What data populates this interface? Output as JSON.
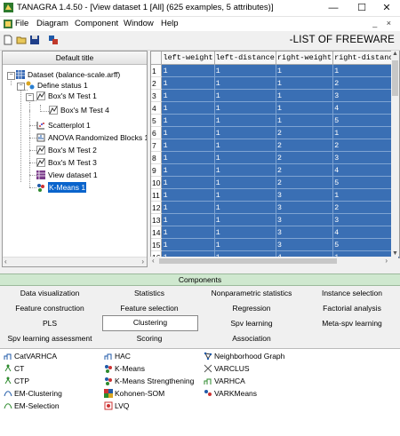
{
  "window": {
    "title": "TANAGRA 1.4.50 - [View dataset 1 [All] (625 examples, 5 attributes)]",
    "minimize": "—",
    "maximize": "☐",
    "close": "✕"
  },
  "menu": {
    "items": [
      "File",
      "Diagram",
      "Component",
      "Window",
      "Help"
    ],
    "mdi_controls": "_ ×"
  },
  "toolbar": {
    "banner": "-LIST OF FREEWARE"
  },
  "tree": {
    "header": "Default title",
    "nodes": [
      {
        "label": "Dataset (balance-scale.arff)",
        "icon": "dataset-icon"
      },
      {
        "label": "Define status 1",
        "icon": "define-status-icon"
      },
      {
        "label": "Box's M Test 1",
        "icon": "boxm-icon"
      },
      {
        "label": "Box's M Test 4",
        "icon": "boxm-icon"
      },
      {
        "label": "Scatterplot 1",
        "icon": "scatterplot-icon"
      },
      {
        "label": "ANOVA Randomized Blocks 1",
        "icon": "anova-icon"
      },
      {
        "label": "Box's M Test 2",
        "icon": "boxm-icon"
      },
      {
        "label": "Box's M Test 3",
        "icon": "boxm-icon"
      },
      {
        "label": "View dataset 1",
        "icon": "view-dataset-icon"
      },
      {
        "label": "K-Means 1",
        "icon": "kmeans-icon"
      }
    ]
  },
  "grid": {
    "columns": [
      "",
      "left-weight",
      "left-distance",
      "right-weight",
      "right-distance"
    ],
    "rows": [
      [
        "1",
        "1",
        "1",
        "1",
        "1"
      ],
      [
        "2",
        "1",
        "1",
        "1",
        "2"
      ],
      [
        "3",
        "1",
        "1",
        "1",
        "3"
      ],
      [
        "4",
        "1",
        "1",
        "1",
        "4"
      ],
      [
        "5",
        "1",
        "1",
        "1",
        "5"
      ],
      [
        "6",
        "1",
        "1",
        "2",
        "1"
      ],
      [
        "7",
        "1",
        "1",
        "2",
        "2"
      ],
      [
        "8",
        "1",
        "1",
        "2",
        "3"
      ],
      [
        "9",
        "1",
        "1",
        "2",
        "4"
      ],
      [
        "10",
        "1",
        "1",
        "2",
        "5"
      ],
      [
        "11",
        "1",
        "1",
        "3",
        "1"
      ],
      [
        "12",
        "1",
        "1",
        "3",
        "2"
      ],
      [
        "13",
        "1",
        "1",
        "3",
        "3"
      ],
      [
        "14",
        "1",
        "1",
        "3",
        "4"
      ],
      [
        "15",
        "1",
        "1",
        "3",
        "5"
      ],
      [
        "16",
        "1",
        "1",
        "4",
        "1"
      ]
    ]
  },
  "components": {
    "header": "Components",
    "tabs": [
      "Data visualization",
      "Statistics",
      "Nonparametric statistics",
      "Instance selection",
      "Feature construction",
      "Feature selection",
      "Regression",
      "Factorial analysis",
      "PLS",
      "Clustering",
      "Spv learning",
      "Meta-spv learning",
      "Spv learning assessment",
      "Scoring",
      "Association"
    ],
    "active_tab": "Clustering",
    "items": [
      {
        "label": "CatVARHCA",
        "icon": "catvarhca-icon"
      },
      {
        "label": "CT",
        "icon": "ct-icon"
      },
      {
        "label": "CTP",
        "icon": "ctp-icon"
      },
      {
        "label": "EM-Clustering",
        "icon": "em-clustering-icon"
      },
      {
        "label": "EM-Selection",
        "icon": "em-selection-icon"
      },
      {
        "label": "HAC",
        "icon": "hac-icon"
      },
      {
        "label": "K-Means",
        "icon": "kmeans-icon"
      },
      {
        "label": "K-Means Strengthening",
        "icon": "kmeans-strengthening-icon"
      },
      {
        "label": "Kohonen-SOM",
        "icon": "kohonen-som-icon"
      },
      {
        "label": "LVQ",
        "icon": "lvq-icon"
      },
      {
        "label": "Neighborhood Graph",
        "icon": "neighborhood-graph-icon"
      },
      {
        "label": "VARCLUS",
        "icon": "varclus-icon"
      },
      {
        "label": "VARHCA",
        "icon": "varhca-icon"
      },
      {
        "label": "VARKMeans",
        "icon": "varkmeans-icon"
      }
    ]
  }
}
